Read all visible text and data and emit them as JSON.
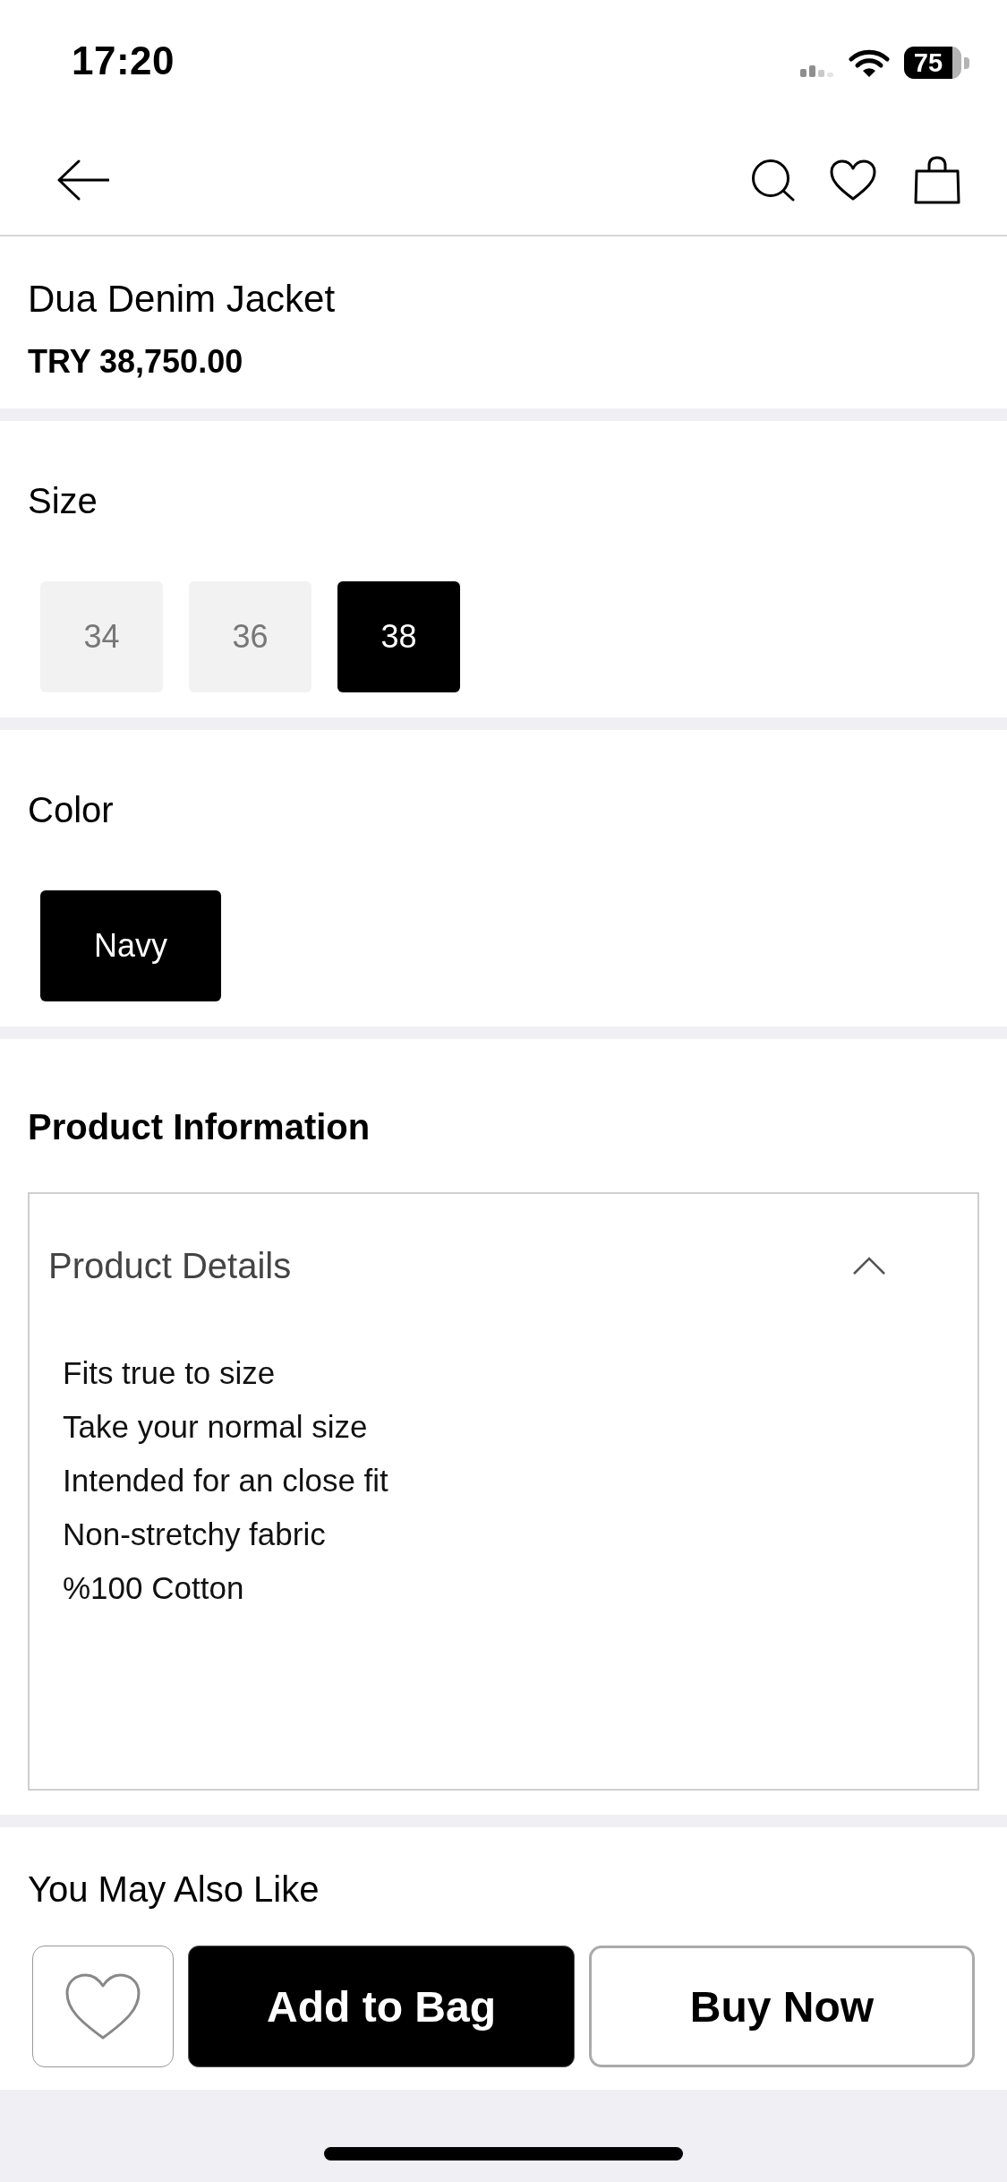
{
  "status_bar": {
    "time": "17:20",
    "battery": "75"
  },
  "product": {
    "name": "Dua Denim Jacket",
    "price": "TRY 38,750.00"
  },
  "size_selector": {
    "label": "Size",
    "options": [
      {
        "label": "34",
        "selected": false
      },
      {
        "label": "36",
        "selected": false
      },
      {
        "label": "38",
        "selected": true
      }
    ]
  },
  "color_selector": {
    "label": "Color",
    "options": [
      {
        "label": "Navy",
        "selected": true
      }
    ]
  },
  "product_information": {
    "title": "Product Information",
    "sections": [
      {
        "title": "Product Details",
        "expanded": true,
        "lines": [
          "Fits true to size",
          "Take your normal size",
          "Intended for an close fit",
          "Non-stretchy fabric",
          "%100 Cotton"
        ]
      }
    ]
  },
  "recommendations": {
    "title": "You May Also Like"
  },
  "action_bar": {
    "buttons": [
      {
        "kind": "favorite"
      },
      {
        "kind": "primary",
        "label": "Add to Bag"
      },
      {
        "kind": "secondary",
        "label": "Buy Now"
      }
    ]
  }
}
